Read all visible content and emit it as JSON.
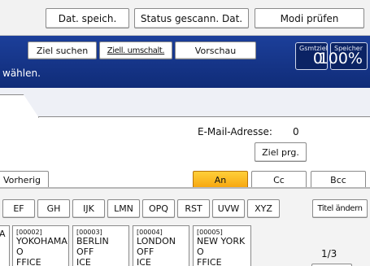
{
  "top_buttons": {
    "store_file": "Dat. speich.",
    "scanned_status": "Status gescann. Dat.",
    "check_modes": "Modi prüfen"
  },
  "blue_bar": {
    "search_dest": "Ziel suchen",
    "switch_dest": "Ziell. umschalt.",
    "preview": "Vorschau",
    "status_text": "wählen.",
    "total_dest_label": "Gsmtziel",
    "total_dest_value": "0",
    "memory_label": "Speicher",
    "memory_value": "100%"
  },
  "email": {
    "label": "E-Mail-Adresse:",
    "count": "0",
    "register_dest": "Ziel prg."
  },
  "recipient_row": {
    "previous": "Vorherig",
    "to": "An",
    "cc": "Cc",
    "bcc": "Bcc"
  },
  "index_tabs": [
    "EF",
    "GH",
    "IJK",
    "LMN",
    "OPQ",
    "RST",
    "UVW",
    "XYZ"
  ],
  "change_title": "Titel ändern",
  "destinations": [
    {
      "num": "",
      "line1": "A",
      "line2": ""
    },
    {
      "num": "[00002]",
      "line1": "YOKOHAMA O",
      "line2": "FFICE"
    },
    {
      "num": "[00003]",
      "line1": "BERLIN OFF",
      "line2": "ICE"
    },
    {
      "num": "[00004]",
      "line1": "LONDON OFF",
      "line2": "ICE"
    },
    {
      "num": "[00005]",
      "line1": "NEW YORK O",
      "line2": "FFICE"
    }
  ],
  "page_indicator": "1/3",
  "colors": {
    "blue_bar": "#1c3f9a",
    "selected_orange": "#f6a40d"
  }
}
